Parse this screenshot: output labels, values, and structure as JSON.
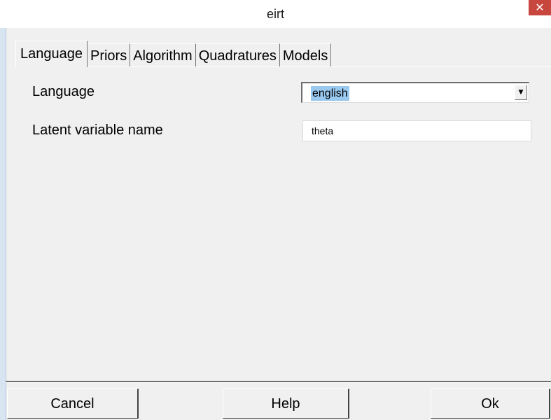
{
  "window": {
    "title": "eirt",
    "close_glyph": "✕"
  },
  "tabs": [
    {
      "label": "Language",
      "active": true
    },
    {
      "label": "Priors",
      "active": false
    },
    {
      "label": "Algorithm",
      "active": false
    },
    {
      "label": "Quadratures",
      "active": false
    },
    {
      "label": "Models",
      "active": false
    }
  ],
  "form": {
    "language_label": "Language",
    "language_value": "english",
    "latent_label": "Latent variable name",
    "latent_value": "theta"
  },
  "buttons": {
    "cancel": "Cancel",
    "help": "Help",
    "ok": "Ok"
  },
  "icons": {
    "close": "close-icon",
    "dropdown": "chevron-down-icon"
  }
}
